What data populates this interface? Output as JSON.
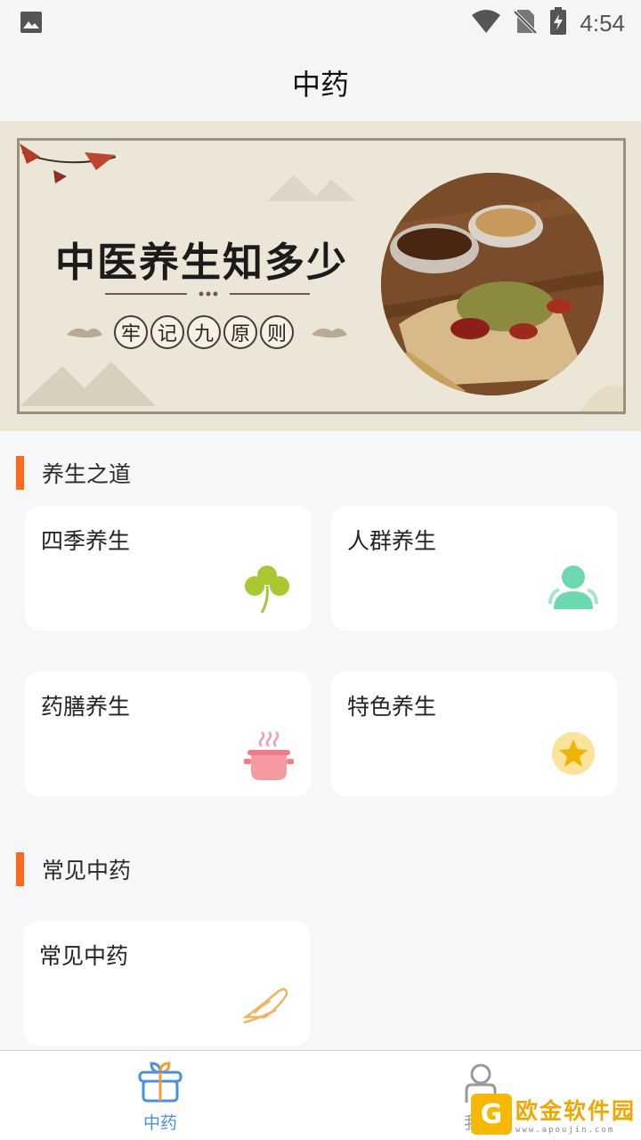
{
  "status_bar": {
    "time": "4:54"
  },
  "app_bar": {
    "title": "中药"
  },
  "banner": {
    "headline": "中医养生知多少",
    "chips": [
      "牢",
      "记",
      "九",
      "原",
      "则"
    ]
  },
  "sections": [
    {
      "title": "养生之道",
      "cards": [
        {
          "label": "四季养生",
          "icon": "clover-icon"
        },
        {
          "label": "人群养生",
          "icon": "people-icon"
        },
        {
          "label": "药膳养生",
          "icon": "pot-icon"
        },
        {
          "label": "特色养生",
          "icon": "star-icon"
        }
      ]
    },
    {
      "title": "常见中药",
      "cards": [
        {
          "label": "常见中药",
          "icon": "herb-icon"
        }
      ]
    }
  ],
  "bottom_nav": {
    "items": [
      {
        "label": "中药",
        "icon": "gift-icon",
        "active": true
      },
      {
        "label": "我的",
        "icon": "user-icon",
        "active": false
      }
    ]
  },
  "watermark": {
    "mark": "G",
    "main": "欧金软件园",
    "sub": "www.apoujin.com"
  },
  "colors": {
    "accent": "#ff6a1c",
    "nav_active": "#4a90e2",
    "nav_inactive": "#999999"
  }
}
